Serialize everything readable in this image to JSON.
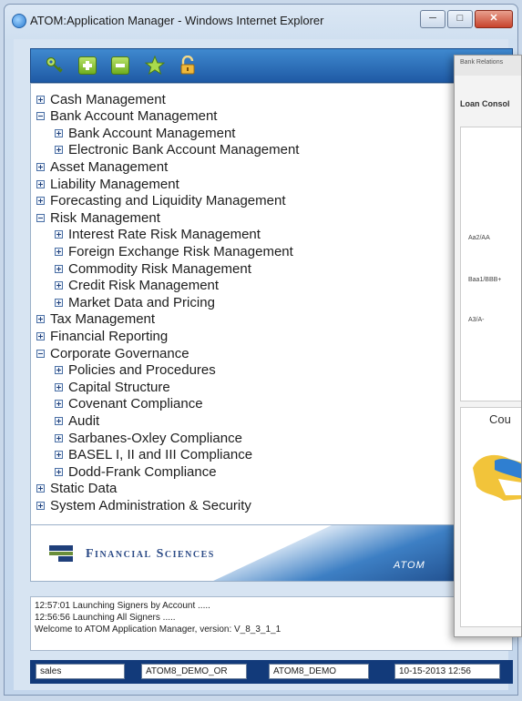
{
  "window": {
    "title": "ATOM:Application Manager - Windows Internet Explorer"
  },
  "toolbar": {
    "icons": [
      "key-icon",
      "expand-plus-icon",
      "collapse-minus-icon",
      "star-icon",
      "lock-icon"
    ]
  },
  "tree": [
    {
      "label": "Cash Management",
      "level": 0,
      "expanded": false
    },
    {
      "label": "Bank Account Management",
      "level": 0,
      "expanded": true
    },
    {
      "label": "Bank Account Management",
      "level": 1,
      "expanded": false
    },
    {
      "label": "Electronic Bank Account Management",
      "level": 1,
      "expanded": false
    },
    {
      "label": "Asset Management",
      "level": 0,
      "expanded": false
    },
    {
      "label": "Liability Management",
      "level": 0,
      "expanded": false
    },
    {
      "label": "Forecasting and Liquidity Management",
      "level": 0,
      "expanded": false
    },
    {
      "label": "Risk Management",
      "level": 0,
      "expanded": true
    },
    {
      "label": "Interest Rate Risk Management",
      "level": 1,
      "expanded": false
    },
    {
      "label": "Foreign Exchange Risk Management",
      "level": 1,
      "expanded": false
    },
    {
      "label": "Commodity Risk Management",
      "level": 1,
      "expanded": false
    },
    {
      "label": "Credit Risk Management",
      "level": 1,
      "expanded": false
    },
    {
      "label": "Market Data and Pricing",
      "level": 1,
      "expanded": false
    },
    {
      "label": "Tax Management",
      "level": 0,
      "expanded": false
    },
    {
      "label": "Financial Reporting",
      "level": 0,
      "expanded": false
    },
    {
      "label": "Corporate Governance",
      "level": 0,
      "expanded": true
    },
    {
      "label": "Policies and Procedures",
      "level": 1,
      "expanded": false
    },
    {
      "label": "Capital Structure",
      "level": 1,
      "expanded": false
    },
    {
      "label": "Covenant Compliance",
      "level": 1,
      "expanded": false
    },
    {
      "label": "Audit",
      "level": 1,
      "expanded": false
    },
    {
      "label": "Sarbanes-Oxley Compliance",
      "level": 1,
      "expanded": false
    },
    {
      "label": "BASEL I, II and III Compliance",
      "level": 1,
      "expanded": false
    },
    {
      "label": "Dodd-Frank Compliance",
      "level": 1,
      "expanded": false
    },
    {
      "label": "Static Data",
      "level": 0,
      "expanded": false
    },
    {
      "label": "System Administration & Security",
      "level": 0,
      "expanded": false
    }
  ],
  "banner": {
    "brand": "Financial Sciences",
    "product": "ATOM"
  },
  "log": [
    "12:57:01 Launching Signers by Account .....",
    "12:56:56 Launching All Signers .....",
    "Welcome to ATOM Application Manager, version: V_8_3_1_1"
  ],
  "status": {
    "user": "sales",
    "db1": "ATOM8_DEMO_OR",
    "db2": "ATOM8_DEMO",
    "datetime": "10-15-2013 12:56"
  },
  "overlay": {
    "header": "Bank Relations",
    "subtitle": "Loan Consol",
    "ratings": [
      "Aa2/AA",
      "Baa1/BBB+",
      "A3/A-"
    ],
    "panel_title": "Cou"
  }
}
